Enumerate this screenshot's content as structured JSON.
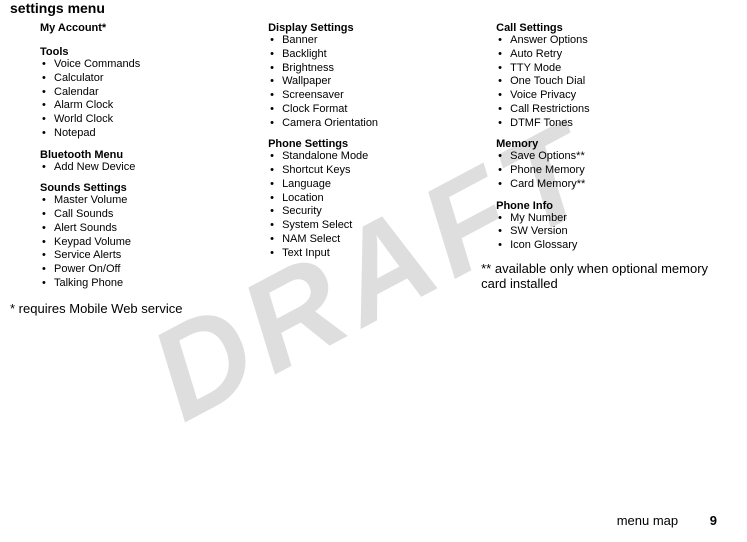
{
  "watermark": "DRAFT",
  "page_title": "settings menu",
  "footer": {
    "label": "menu map",
    "page_number": "9"
  },
  "col1": {
    "sections": [
      {
        "header": "My Account*",
        "items": []
      },
      {
        "header": "Tools",
        "items": [
          "Voice Commands",
          "Calculator",
          "Calendar",
          "Alarm Clock",
          "World Clock",
          "Notepad"
        ]
      },
      {
        "header": "Bluetooth Menu",
        "items": [
          "Add New Device"
        ]
      },
      {
        "header": "Sounds Settings",
        "items": [
          "Master Volume",
          "Call Sounds",
          "Alert Sounds",
          "Keypad Volume",
          "Service Alerts",
          "Power On/Off",
          "Talking Phone"
        ]
      }
    ],
    "footnote": "* requires Mobile Web service"
  },
  "col2": {
    "sections": [
      {
        "header": "Display Settings",
        "items": [
          "Banner",
          "Backlight",
          "Brightness",
          "Wallpaper",
          "Screensaver",
          "Clock Format",
          "Camera Orientation"
        ]
      },
      {
        "header": "Phone Settings",
        "items": [
          "Standalone Mode",
          "Shortcut Keys",
          "Language",
          "Location",
          "Security",
          "System Select",
          "NAM Select",
          "Text Input"
        ]
      }
    ]
  },
  "col3": {
    "sections": [
      {
        "header": "Call Settings",
        "items": [
          "Answer Options",
          "Auto Retry",
          "TTY Mode",
          "One Touch Dial",
          "Voice Privacy",
          "Call Restrictions",
          "DTMF Tones"
        ]
      },
      {
        "header": "Memory",
        "items": [
          "Save Options**",
          "Phone Memory",
          "Card Memory**"
        ]
      },
      {
        "header": "Phone Info",
        "items": [
          "My Number",
          "SW Version",
          "Icon Glossary"
        ]
      }
    ],
    "footnote": "** available only when optional memory card installed"
  }
}
